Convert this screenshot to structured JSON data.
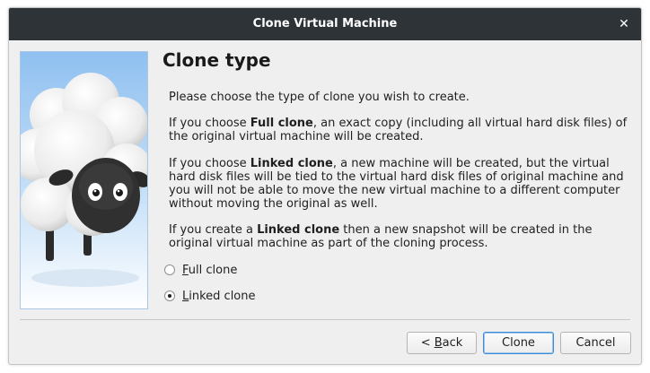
{
  "window": {
    "title": "Clone Virtual Machine",
    "close_glyph": "✕"
  },
  "page": {
    "title": "Clone type",
    "intro": "Please choose the type of clone you wish to create.",
    "full_desc": {
      "pre": "If you choose ",
      "bold": "Full clone",
      "post": ", an exact copy (including all virtual hard disk files) of the original virtual machine will be created."
    },
    "linked_desc": {
      "pre": "If you choose ",
      "bold": "Linked clone",
      "post": ", a new machine will be created, but the virtual hard disk files will be tied to the virtual hard disk files of original machine and you will not be able to move the new virtual machine to a different computer without moving the original as well."
    },
    "snapshot_desc": {
      "pre": "If you create a ",
      "bold": "Linked clone",
      "post": " then a new snapshot will be created in the original virtual machine as part of the cloning process."
    }
  },
  "options": {
    "full": {
      "mnemonic": "F",
      "rest": "ull clone",
      "checked": false
    },
    "linked": {
      "mnemonic": "L",
      "rest": "inked clone",
      "checked": true
    }
  },
  "buttons": {
    "back_prefix": "< ",
    "back_mnemonic": "B",
    "back_rest": "ack",
    "clone": "Clone",
    "cancel": "Cancel"
  },
  "colors": {
    "titlebar": "#2e3338",
    "accent": "#3c8bd6",
    "wizard_sky": "#a8cdf2"
  },
  "icons": {
    "close": "close-icon",
    "wizard": "sheep-illustration"
  }
}
